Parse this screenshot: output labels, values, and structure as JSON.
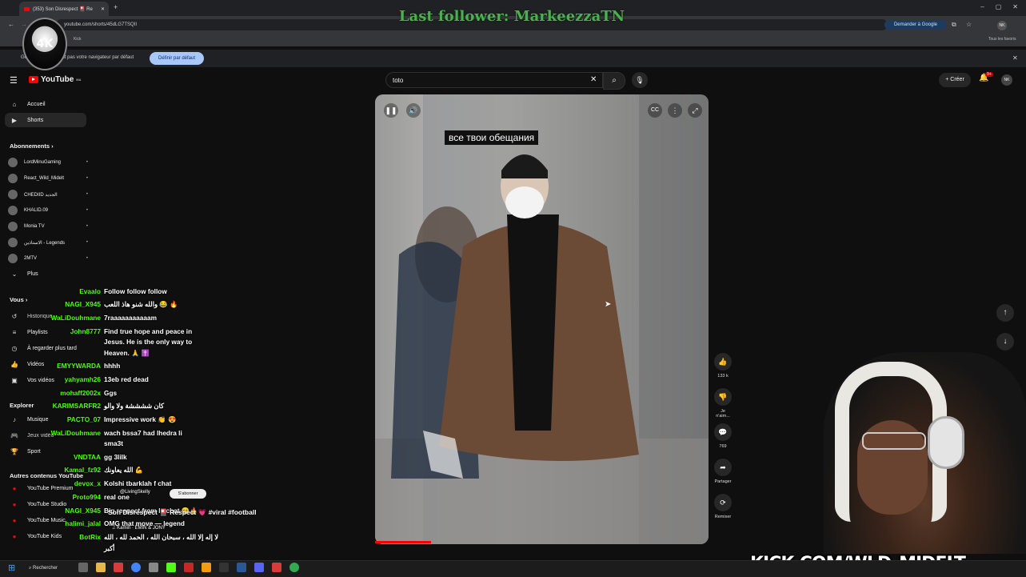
{
  "browser": {
    "tab_title": "(353) Son Disrespect 🎴 Re",
    "url": "youtube.com/shorts/45dLG7TSQII",
    "bookmarks": [
      "Kick",
      "Tous les favoris"
    ],
    "infobar_text": "Google Chrome n'est pas votre navigateur par défaut",
    "infobar_button": "Définir par défaut",
    "ask_google": "Demander à Google",
    "profile_initials": "NK"
  },
  "overlay": {
    "last_follower": "Last follower: MarkeezzaTN",
    "logo_text": "4K",
    "kick_banner": "KICK.COM/WLD_MIDELT"
  },
  "youtube": {
    "logo": "YouTube",
    "logo_suffix": "MA",
    "search_value": "toto",
    "create_label": "Créer",
    "bell_badge": "9+",
    "avatar_initials": "NK"
  },
  "sidebar": {
    "main": [
      {
        "icon": "⌂",
        "label": "Accueil"
      },
      {
        "icon": "▶",
        "label": "Shorts"
      }
    ],
    "subs_heading": "Abonnements",
    "subs": [
      {
        "label": "LordMinuGaming"
      },
      {
        "label": "React_Wild_Midelt"
      },
      {
        "label": "CHEDIID الجديد"
      },
      {
        "label": "KHALID.09"
      },
      {
        "label": "Monia TV"
      },
      {
        "label": "الاستاذين - Legends"
      },
      {
        "label": "2MTV"
      }
    ],
    "more": "Plus",
    "you_heading": "Vous",
    "you_items": [
      {
        "icon": "↺",
        "label": "Historique"
      },
      {
        "icon": "≡",
        "label": "Playlists"
      },
      {
        "icon": "◷",
        "label": "À regarder plus tard"
      },
      {
        "icon": "👍",
        "label": "Vidéos"
      },
      {
        "icon": "▣",
        "label": "Vos vidéos"
      }
    ],
    "explore_heading": "Explorer",
    "explore_items": [
      {
        "icon": "♪",
        "label": "Musique"
      },
      {
        "icon": "🎮",
        "label": "Jeux vidéo"
      },
      {
        "icon": "🏆",
        "label": "Sport"
      }
    ],
    "other_heading": "Autres contenus YouTube",
    "other_items": [
      {
        "label": "YouTube Premium"
      },
      {
        "label": "YouTube Studio"
      },
      {
        "label": "YouTube Music"
      },
      {
        "label": "YouTube Kids"
      }
    ]
  },
  "chat": [
    {
      "user": "Evaalo",
      "msg": "Follow follow follow"
    },
    {
      "user": "NAGI_X945",
      "msg": "والله شنو هاذ اللعب 😂 🔥"
    },
    {
      "user": "WaLiDouhmane",
      "msg": "7raaaaaaaaaaam"
    },
    {
      "user": "John8777",
      "msg": "Find true hope and peace in"
    },
    {
      "user": "",
      "msg": "Jesus. He is the only way to"
    },
    {
      "user": "",
      "msg": "Heaven. 🙏 ✝️"
    },
    {
      "user": "EMYYWARDA",
      "msg": "hhhh"
    },
    {
      "user": "yahyamh26",
      "msg": "13eb red dead"
    },
    {
      "user": "mohaff2002x",
      "msg": "Ggs"
    },
    {
      "user": "KARIMSARFR2",
      "msg": "كان ششششة ولا والو"
    },
    {
      "user": "PACTO_07",
      "msg": "Impressive work 👏 😍"
    },
    {
      "user": "WaLiDouhmane",
      "msg": "wach bssa7 had lhedra li"
    },
    {
      "user": "",
      "msg": "sma3t"
    },
    {
      "user": "VNDTAA",
      "msg": "gg 3lilk"
    },
    {
      "user": "Kamal_fz92",
      "msg": "الله يعاونك 💪"
    },
    {
      "user": "devox_x",
      "msg": "Kolshi tbarklah f chat"
    },
    {
      "user": "Proto994",
      "msg": "real one"
    },
    {
      "user": "NAGI_X945",
      "msg": "Big respect from le chat 😁🔥"
    },
    {
      "user": "halimi_jalal",
      "msg": "OMG that move — legend"
    },
    {
      "user": "BotRix",
      "msg": "لا إله إلا الله ، سبحان الله ، الحمد لله ، الله"
    },
    {
      "user": "",
      "msg": "أكبر"
    }
  ],
  "short": {
    "caption": "все твои обещания",
    "channel": "@LivingSkelly",
    "subscribe": "S'abonner",
    "title": "Son Disrespect 🎴 Respect 💗 #viral #football",
    "music": "♫ Kamin · EMIN & JONY",
    "actions": [
      {
        "icon": "👍",
        "label": "133 k"
      },
      {
        "icon": "👎",
        "label": "Je n'aim..."
      },
      {
        "icon": "💬",
        "label": "769"
      },
      {
        "icon": "➦",
        "label": "Partager"
      },
      {
        "icon": "⟳",
        "label": "Remixer"
      }
    ]
  },
  "taskbar": {
    "search": "Rechercher"
  }
}
